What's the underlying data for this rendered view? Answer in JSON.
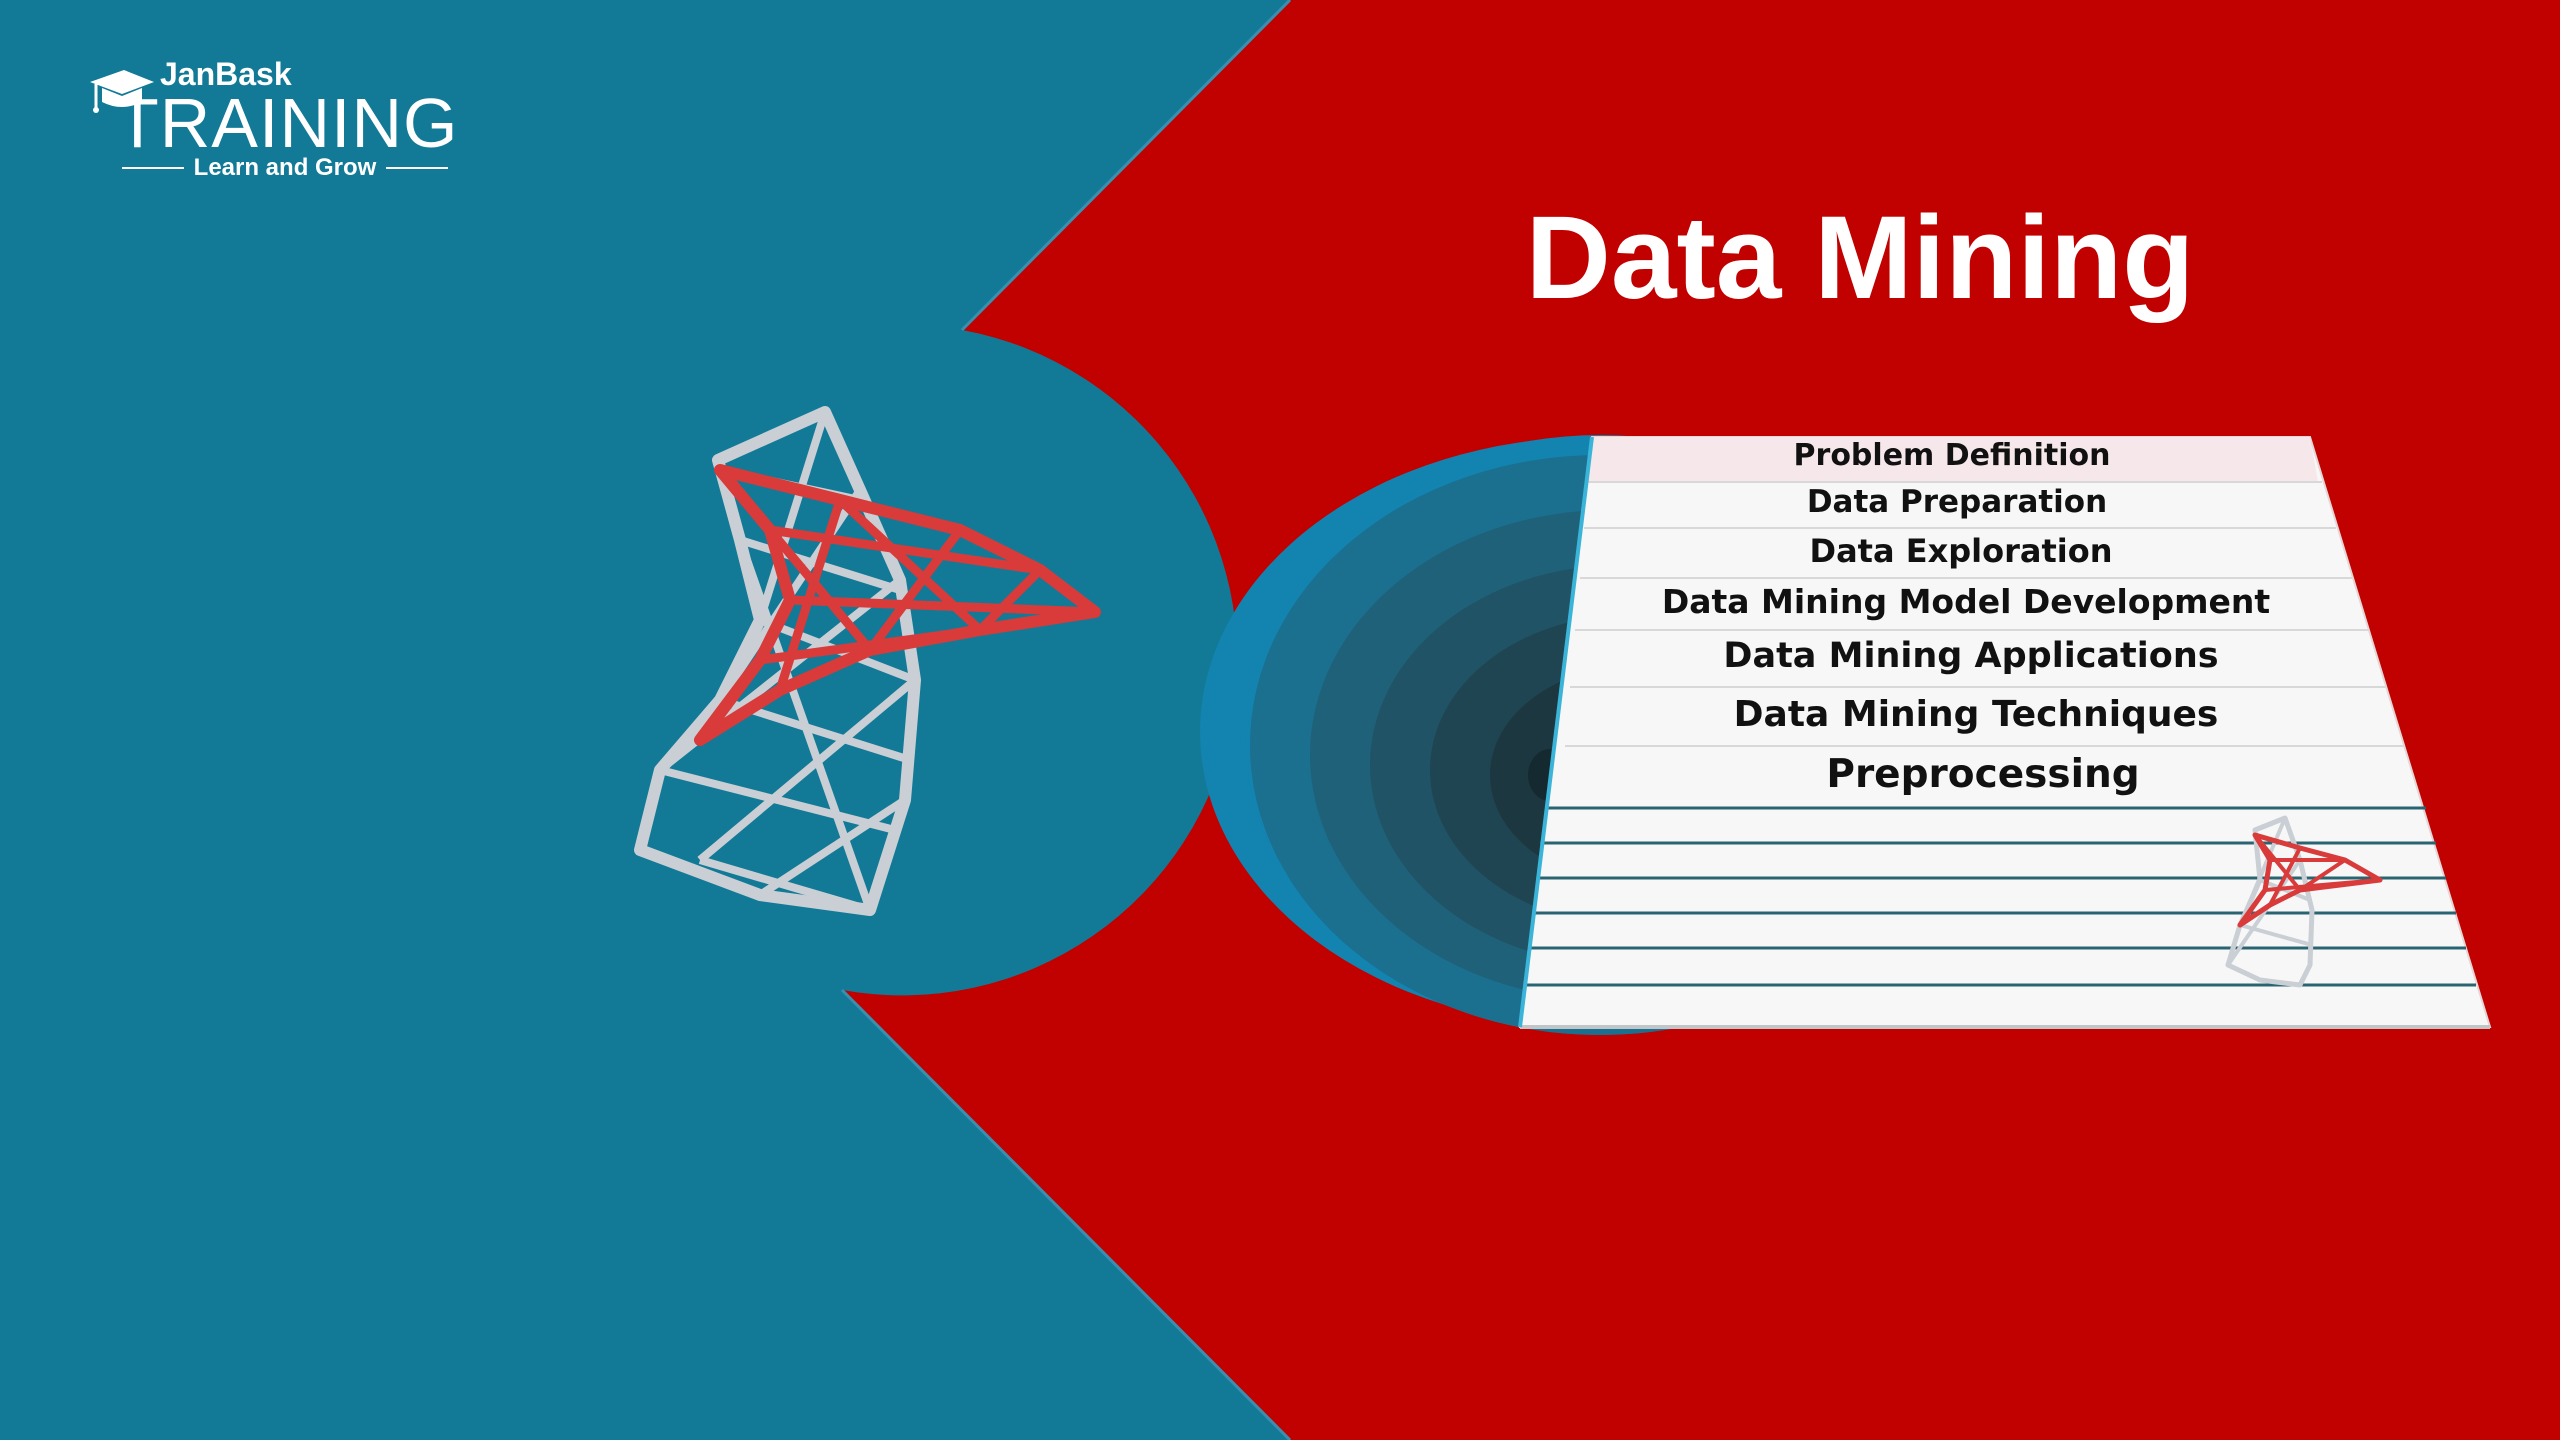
{
  "logo": {
    "brand": "JanBask",
    "wordmark": "TRAINING",
    "tagline": "Learn and Grow"
  },
  "title": "Data Mining",
  "steps": [
    "Problem Definition",
    "Data Preparation",
    "Data Exploration",
    "Data Mining Model Development",
    "Data Mining Applications",
    "Data Mining Techniques",
    "Preprocessing"
  ],
  "colors": {
    "teal": "#127a97",
    "red": "#c10000",
    "white": "#ffffff",
    "accent_red": "#d93a3a",
    "silver": "#c9cfd4"
  },
  "icons": {
    "logo_cap": "graduation-cap-icon",
    "main_graphic": "sql-server-logo-icon",
    "small_graphic": "sql-server-logo-icon"
  }
}
